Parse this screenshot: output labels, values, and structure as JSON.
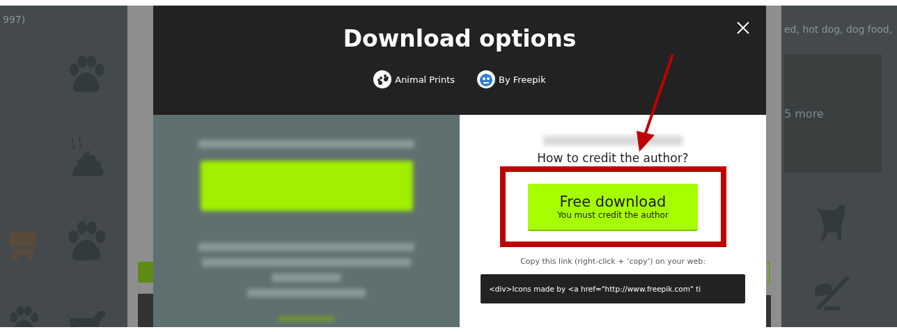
{
  "background": {
    "left_caption": "997)",
    "right_caption": "ed, hot dog, dog food,",
    "more_label": "5 more"
  },
  "dialog": {
    "title": "Download options",
    "tags": [
      {
        "label": "Animal Prints",
        "kind": "pack"
      },
      {
        "label": "By Freepik",
        "kind": "author"
      }
    ],
    "credit_heading": "How to credit the author?",
    "free_download": {
      "title": "Free download",
      "subtitle": "You must credit the author"
    },
    "copy_hint": "Copy this link (right-click + ‘copy’) on your web:",
    "embed_code": "<div>Icons made by <a href=\"http://www.freepik.com\" ti"
  }
}
